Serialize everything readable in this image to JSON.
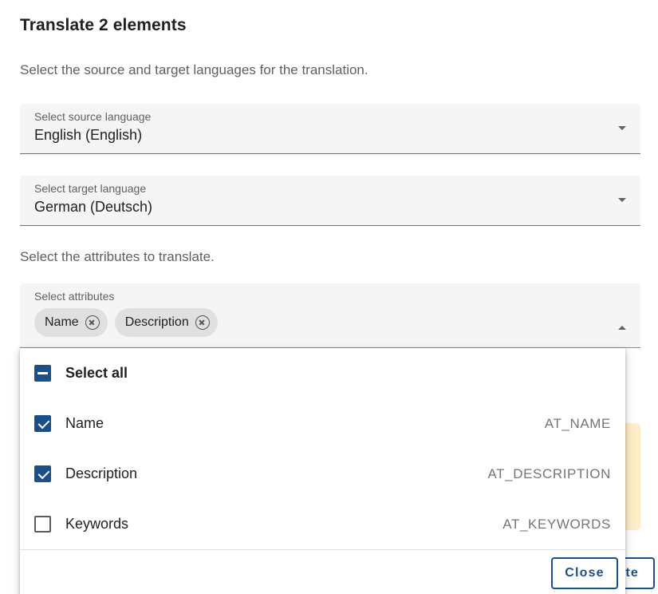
{
  "dialog": {
    "title": "Translate 2 elements",
    "intro": "Select the source and target languages for the translation.",
    "attributes_intro": "Select the attributes to translate."
  },
  "source_language": {
    "label": "Select source language",
    "value": "English (English)"
  },
  "target_language": {
    "label": "Select target language",
    "value": "German (Deutsch)"
  },
  "attributes": {
    "label": "Select attributes",
    "chips": [
      "Name",
      "Description"
    ]
  },
  "dropdown": {
    "options": [
      {
        "label": "Select all",
        "code": "",
        "state": "indeterminate"
      },
      {
        "label": "Name",
        "code": "AT_NAME",
        "state": "checked"
      },
      {
        "label": "Description",
        "code": "AT_DESCRIPTION",
        "state": "checked"
      },
      {
        "label": "Keywords",
        "code": "AT_KEYWORDS",
        "state": "unchecked"
      }
    ],
    "close_label": "Close"
  },
  "footer": {
    "translate_visible_label": "te"
  },
  "colors": {
    "primary": "#1a4f8b",
    "field_bg": "#f5f5f5",
    "chip_bg": "#e0e0e0",
    "warning_bg": "#fdeec8"
  },
  "icons": {
    "dropdown": "caret-down-icon",
    "dropdown_open": "caret-up-icon",
    "chip_remove": "circle-x-icon"
  }
}
